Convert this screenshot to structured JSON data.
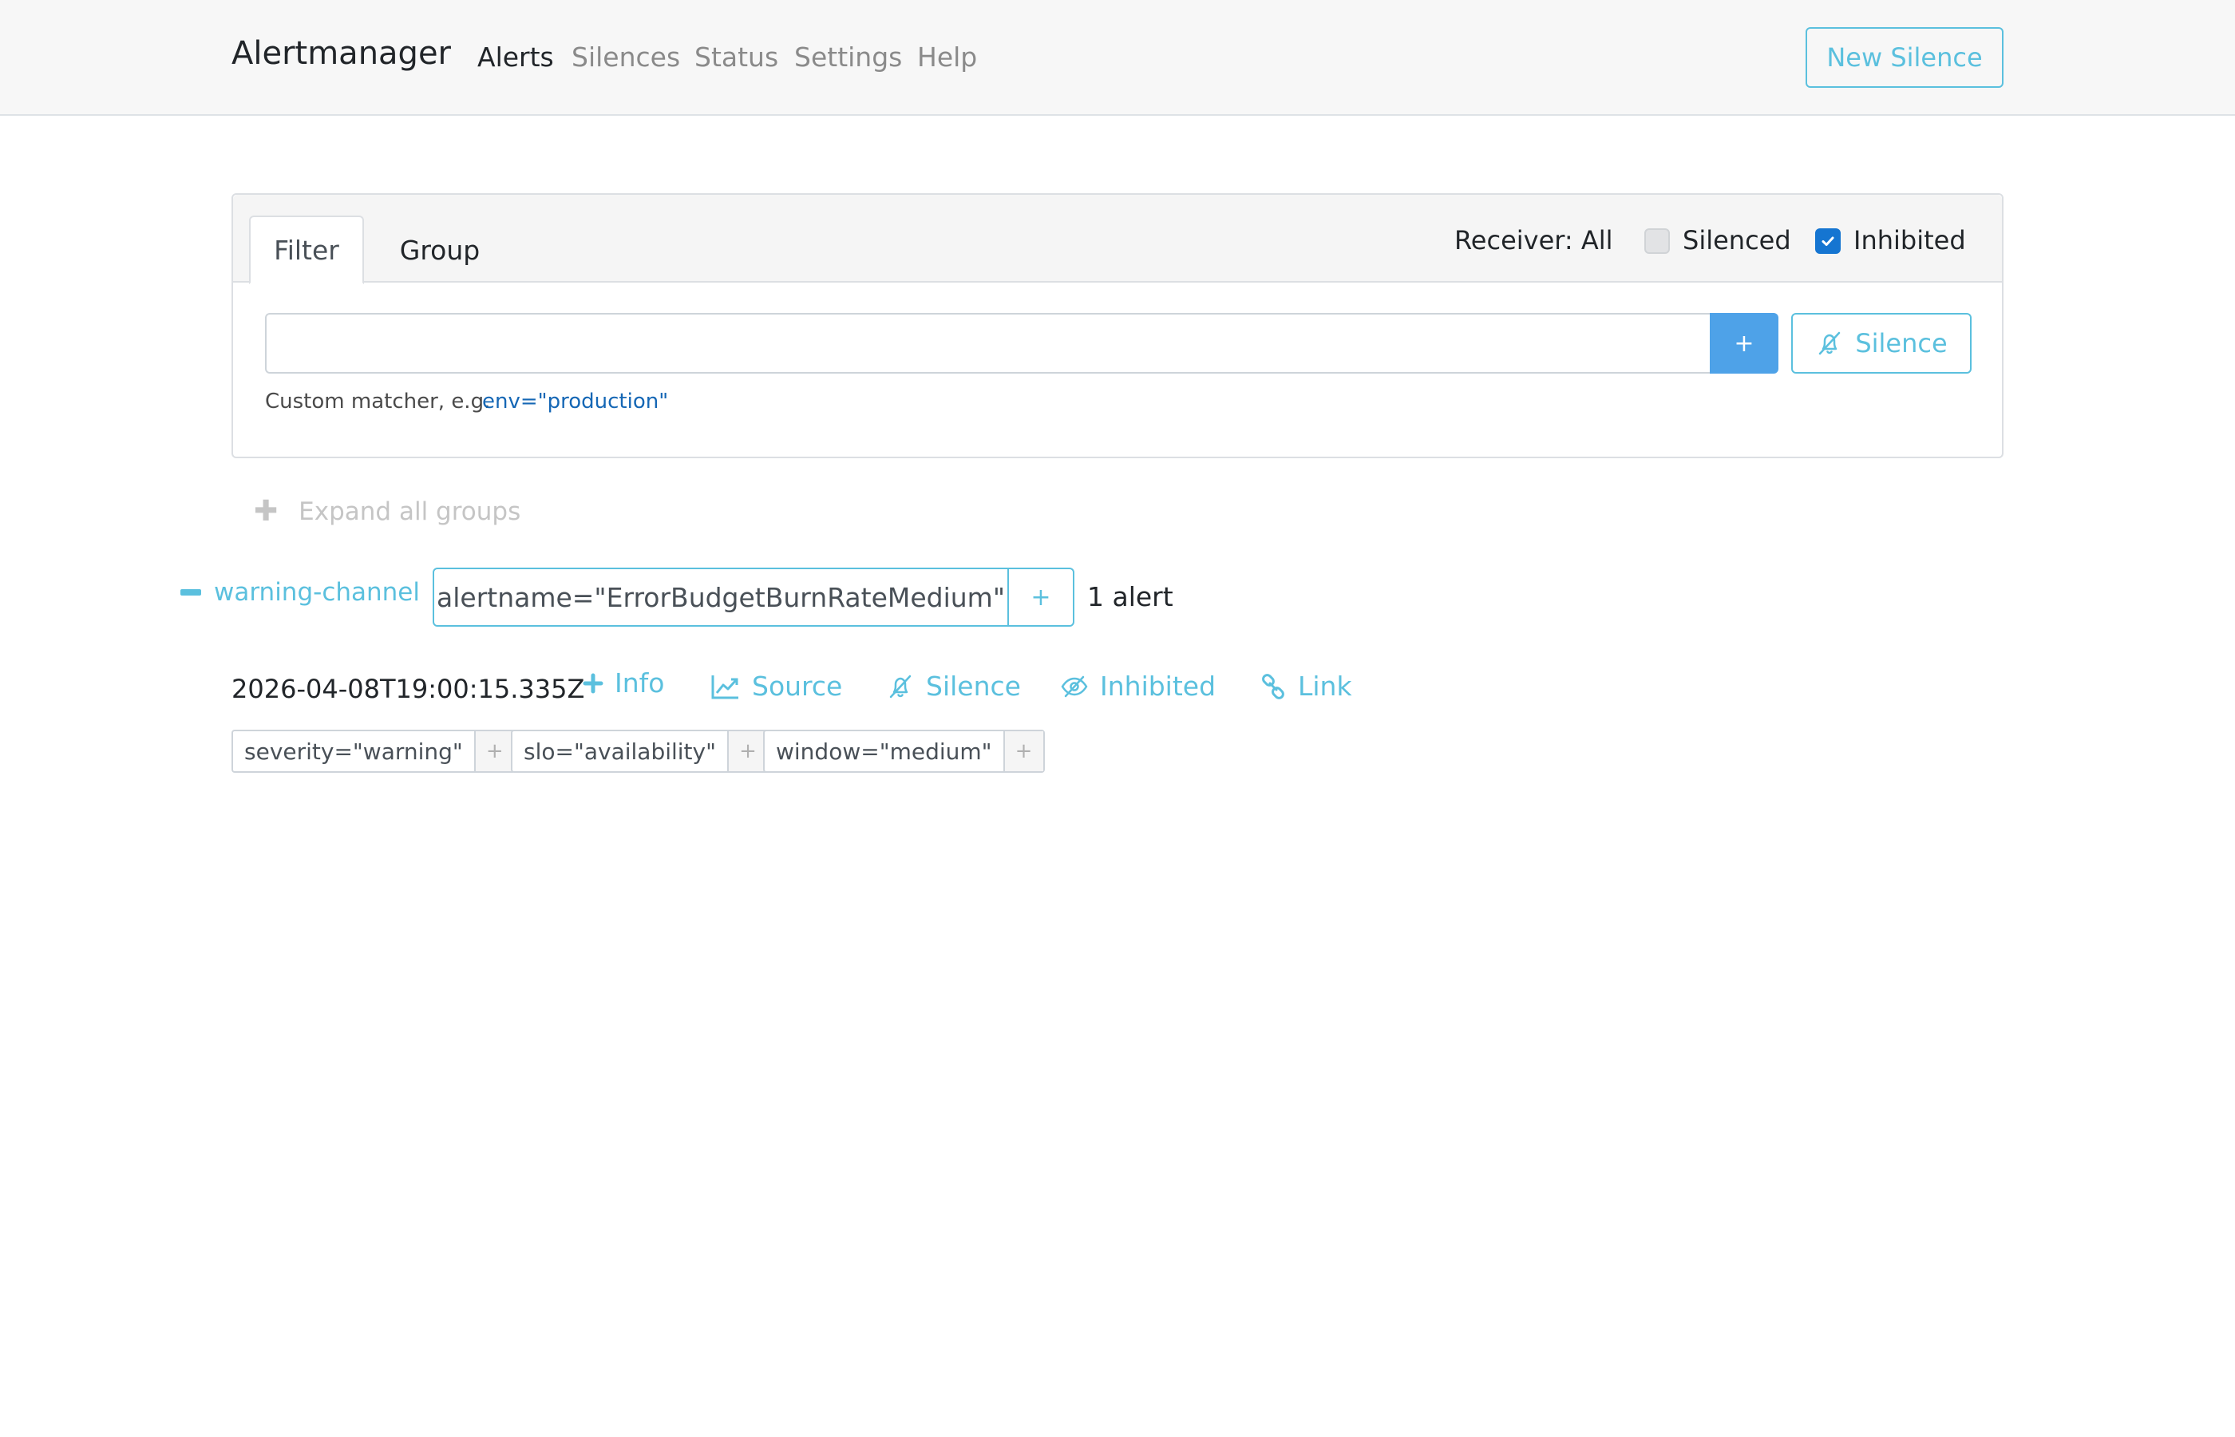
{
  "navbar": {
    "brand": "Alertmanager",
    "links": [
      {
        "label": "Alerts",
        "active": true
      },
      {
        "label": "Silences",
        "active": false
      },
      {
        "label": "Status",
        "active": false
      },
      {
        "label": "Settings",
        "active": false
      },
      {
        "label": "Help",
        "active": false
      }
    ],
    "new_silence_label": "New Silence"
  },
  "filter_card": {
    "tabs": [
      "Filter",
      "Group"
    ],
    "active_tab": "Filter",
    "receiver_label": "Receiver: All",
    "silenced": {
      "label": "Silenced",
      "checked": false
    },
    "inhibited": {
      "label": "Inhibited",
      "checked": true
    },
    "input_value": "",
    "add_label": "+",
    "silence_label": "Silence",
    "hint": "Custom matcher, e.g.",
    "hint_example": "env=\"production\""
  },
  "expand_all": {
    "label": "Expand all groups"
  },
  "group": {
    "name": "warning-channel",
    "matcher": "alertname=\"ErrorBudgetBurnRateMedium\"",
    "matcher_add": "+",
    "count": "1 alert"
  },
  "alert": {
    "timestamp": "2026-04-08T19:00:15.335Z",
    "actions": {
      "info": "Info",
      "source": "Source",
      "silence": "Silence",
      "inhibited": "Inhibited",
      "link": "Link"
    },
    "labels": [
      {
        "text": "severity=\"warning\"",
        "add": "+"
      },
      {
        "text": "slo=\"availability\"",
        "add": "+"
      },
      {
        "text": "window=\"medium\"",
        "add": "+"
      }
    ]
  },
  "colors": {
    "accent": "#5bc0de",
    "primary": "#4ea2e8",
    "checkbox_checked": "#1575d1",
    "link_blue": "#1567b5"
  }
}
